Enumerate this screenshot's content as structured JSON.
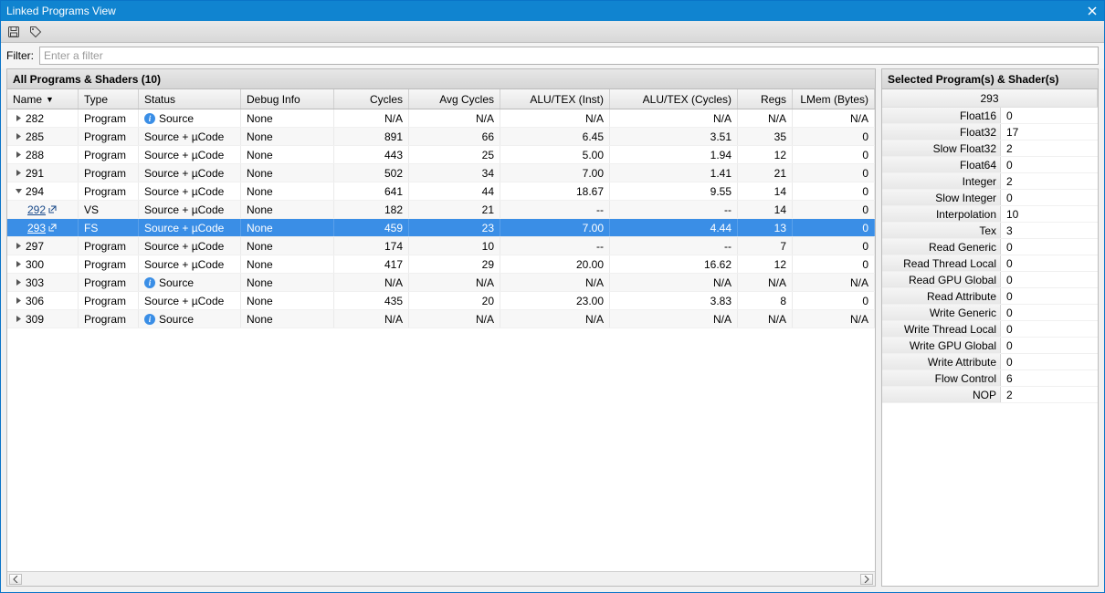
{
  "window": {
    "title": "Linked Programs View"
  },
  "toolbar": {
    "icon_save": "save-icon",
    "icon_tag": "tag-icon"
  },
  "filter": {
    "label": "Filter:",
    "placeholder": "Enter a filter",
    "value": ""
  },
  "left": {
    "heading": "All Programs & Shaders (10)",
    "columns": {
      "name": "Name",
      "type": "Type",
      "status": "Status",
      "debug": "Debug Info",
      "cycles": "Cycles",
      "avg": "Avg Cycles",
      "alui": "ALU/TEX (Inst)",
      "aluc": "ALU/TEX (Cycles)",
      "regs": "Regs",
      "lmem": "LMem (Bytes)"
    },
    "rows": [
      {
        "indent": 0,
        "tree": "closed",
        "name": "282",
        "link": false,
        "type": "Program",
        "status": "Source",
        "statusInfo": true,
        "debug": "None",
        "cycles": "N/A",
        "avg": "N/A",
        "alui": "N/A",
        "aluc": "N/A",
        "regs": "N/A",
        "lmem": "N/A",
        "selected": false
      },
      {
        "indent": 0,
        "tree": "closed",
        "name": "285",
        "link": false,
        "type": "Program",
        "status": "Source + µCode",
        "statusInfo": false,
        "debug": "None",
        "cycles": "891",
        "avg": "66",
        "alui": "6.45",
        "aluc": "3.51",
        "regs": "35",
        "lmem": "0",
        "selected": false
      },
      {
        "indent": 0,
        "tree": "closed",
        "name": "288",
        "link": false,
        "type": "Program",
        "status": "Source + µCode",
        "statusInfo": false,
        "debug": "None",
        "cycles": "443",
        "avg": "25",
        "alui": "5.00",
        "aluc": "1.94",
        "regs": "12",
        "lmem": "0",
        "selected": false
      },
      {
        "indent": 0,
        "tree": "closed",
        "name": "291",
        "link": false,
        "type": "Program",
        "status": "Source + µCode",
        "statusInfo": false,
        "debug": "None",
        "cycles": "502",
        "avg": "34",
        "alui": "7.00",
        "aluc": "1.41",
        "regs": "21",
        "lmem": "0",
        "selected": false
      },
      {
        "indent": 0,
        "tree": "open",
        "name": "294",
        "link": false,
        "type": "Program",
        "status": "Source + µCode",
        "statusInfo": false,
        "debug": "None",
        "cycles": "641",
        "avg": "44",
        "alui": "18.67",
        "aluc": "9.55",
        "regs": "14",
        "lmem": "0",
        "selected": false
      },
      {
        "indent": 1,
        "tree": "none",
        "name": "292",
        "link": true,
        "ext": true,
        "type": "VS",
        "status": "Source + µCode",
        "statusInfo": false,
        "debug": "None",
        "cycles": "182",
        "avg": "21",
        "alui": "--",
        "aluc": "--",
        "regs": "14",
        "lmem": "0",
        "selected": false
      },
      {
        "indent": 1,
        "tree": "none",
        "name": "293",
        "link": true,
        "ext": true,
        "type": "FS",
        "status": "Source + µCode",
        "statusInfo": false,
        "debug": "None",
        "cycles": "459",
        "avg": "23",
        "alui": "7.00",
        "aluc": "4.44",
        "regs": "13",
        "lmem": "0",
        "selected": true
      },
      {
        "indent": 0,
        "tree": "closed",
        "name": "297",
        "link": false,
        "type": "Program",
        "status": "Source + µCode",
        "statusInfo": false,
        "debug": "None",
        "cycles": "174",
        "avg": "10",
        "alui": "--",
        "aluc": "--",
        "regs": "7",
        "lmem": "0",
        "selected": false
      },
      {
        "indent": 0,
        "tree": "closed",
        "name": "300",
        "link": false,
        "type": "Program",
        "status": "Source + µCode",
        "statusInfo": false,
        "debug": "None",
        "cycles": "417",
        "avg": "29",
        "alui": "20.00",
        "aluc": "16.62",
        "regs": "12",
        "lmem": "0",
        "selected": false
      },
      {
        "indent": 0,
        "tree": "closed",
        "name": "303",
        "link": false,
        "type": "Program",
        "status": "Source",
        "statusInfo": true,
        "debug": "None",
        "cycles": "N/A",
        "avg": "N/A",
        "alui": "N/A",
        "aluc": "N/A",
        "regs": "N/A",
        "lmem": "N/A",
        "selected": false
      },
      {
        "indent": 0,
        "tree": "closed",
        "name": "306",
        "link": false,
        "type": "Program",
        "status": "Source + µCode",
        "statusInfo": false,
        "debug": "None",
        "cycles": "435",
        "avg": "20",
        "alui": "23.00",
        "aluc": "3.83",
        "regs": "8",
        "lmem": "0",
        "selected": false
      },
      {
        "indent": 0,
        "tree": "closed",
        "name": "309",
        "link": false,
        "type": "Program",
        "status": "Source",
        "statusInfo": true,
        "debug": "None",
        "cycles": "N/A",
        "avg": "N/A",
        "alui": "N/A",
        "aluc": "N/A",
        "regs": "N/A",
        "lmem": "N/A",
        "selected": false
      }
    ]
  },
  "right": {
    "heading": "Selected Program(s) & Shader(s)",
    "selectedId": "293",
    "props": [
      {
        "label": "Float16",
        "value": "0"
      },
      {
        "label": "Float32",
        "value": "17"
      },
      {
        "label": "Slow Float32",
        "value": "2"
      },
      {
        "label": "Float64",
        "value": "0"
      },
      {
        "label": "Integer",
        "value": "2"
      },
      {
        "label": "Slow Integer",
        "value": "0"
      },
      {
        "label": "Interpolation",
        "value": "10"
      },
      {
        "label": "Tex",
        "value": "3"
      },
      {
        "label": "Read Generic",
        "value": "0"
      },
      {
        "label": "Read Thread Local",
        "value": "0"
      },
      {
        "label": "Read GPU Global",
        "value": "0"
      },
      {
        "label": "Read Attribute",
        "value": "0"
      },
      {
        "label": "Write Generic",
        "value": "0"
      },
      {
        "label": "Write Thread Local",
        "value": "0"
      },
      {
        "label": "Write GPU Global",
        "value": "0"
      },
      {
        "label": "Write Attribute",
        "value": "0"
      },
      {
        "label": "Flow Control",
        "value": "6"
      },
      {
        "label": "NOP",
        "value": "2"
      }
    ]
  }
}
